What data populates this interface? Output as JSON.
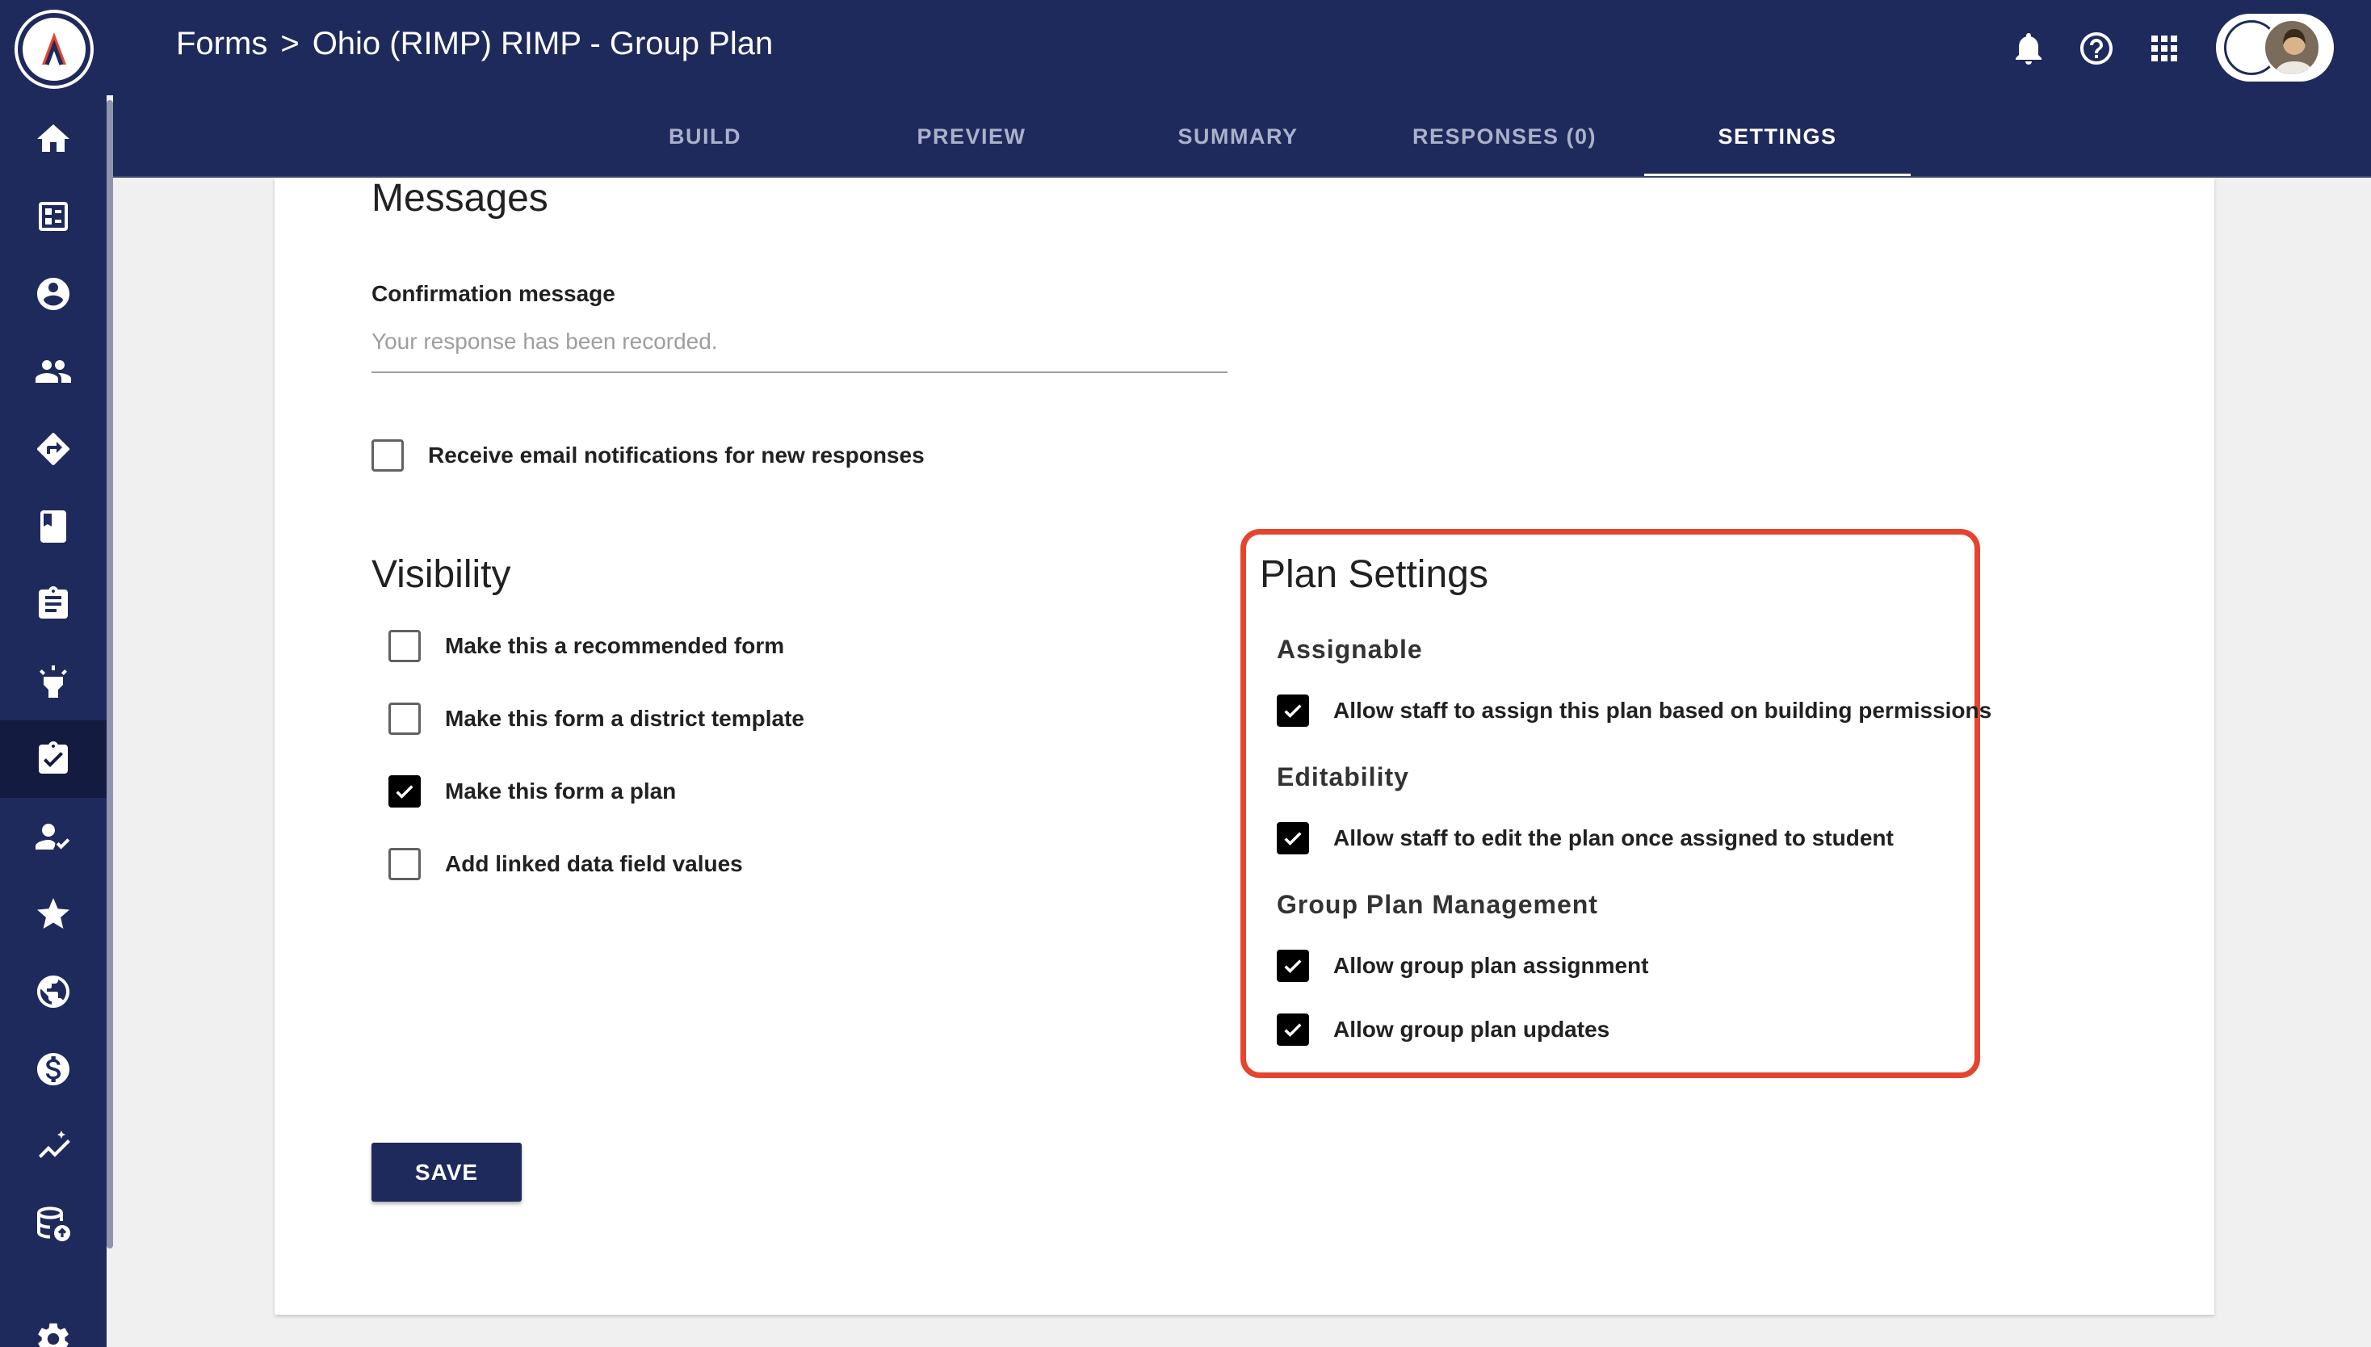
{
  "header": {
    "breadcrumb_root": "Forms",
    "breadcrumb_separator": ">",
    "breadcrumb_current": "Ohio (RIMP) RIMP - Group Plan",
    "icons": [
      "bell-icon",
      "help-icon",
      "apps-grid-icon",
      "account-avatar"
    ]
  },
  "tabs": [
    {
      "label": "BUILD",
      "active": false
    },
    {
      "label": "PREVIEW",
      "active": false
    },
    {
      "label": "SUMMARY",
      "active": false
    },
    {
      "label": "RESPONSES (0)",
      "active": false
    },
    {
      "label": "SETTINGS",
      "active": true
    }
  ],
  "sidebar": {
    "items": [
      {
        "icon": "home-icon"
      },
      {
        "icon": "dashboard-icon"
      },
      {
        "icon": "account-circle-icon"
      },
      {
        "icon": "people-icon"
      },
      {
        "icon": "directions-icon"
      },
      {
        "icon": "book-icon"
      },
      {
        "icon": "clipboard-icon"
      },
      {
        "icon": "lightbulb-icon"
      },
      {
        "icon": "assignment-check-icon",
        "active": true
      },
      {
        "icon": "person-check-icon"
      },
      {
        "icon": "star-icon"
      },
      {
        "icon": "globe-icon"
      },
      {
        "icon": "dollar-icon"
      },
      {
        "icon": "trending-icon"
      },
      {
        "icon": "database-upload-icon"
      },
      {
        "icon": "gear-icon"
      }
    ]
  },
  "messages": {
    "heading": "Messages",
    "confirmation_label": "Confirmation message",
    "confirmation_placeholder": "Your response has been recorded.",
    "email_notifications": {
      "label": "Receive email notifications for new responses",
      "checked": false
    }
  },
  "visibility": {
    "heading": "Visibility",
    "options": [
      {
        "label": "Make this a recommended form",
        "checked": false
      },
      {
        "label": "Make this form a district template",
        "checked": false
      },
      {
        "label": "Make this form a plan",
        "checked": true
      },
      {
        "label": "Add linked data field values",
        "checked": false
      }
    ]
  },
  "plan_settings": {
    "heading": "Plan Settings",
    "highlight_color": "#e5452f",
    "assignable": {
      "heading": "Assignable",
      "option": {
        "label": "Allow staff to assign this plan based on building permissions",
        "checked": true
      }
    },
    "editability": {
      "heading": "Editability",
      "option": {
        "label": "Allow staff to edit the plan once assigned to student",
        "checked": true
      }
    },
    "group_plan_management": {
      "heading": "Group Plan Management",
      "options": [
        {
          "label": "Allow group plan assignment",
          "checked": true
        },
        {
          "label": "Allow group plan updates",
          "checked": true
        }
      ]
    }
  },
  "actions": {
    "save_label": "SAVE"
  },
  "colors": {
    "nav_bg": "#1f2a5c",
    "nav_active": "#131b40",
    "page_bg": "#f0f0f0"
  }
}
